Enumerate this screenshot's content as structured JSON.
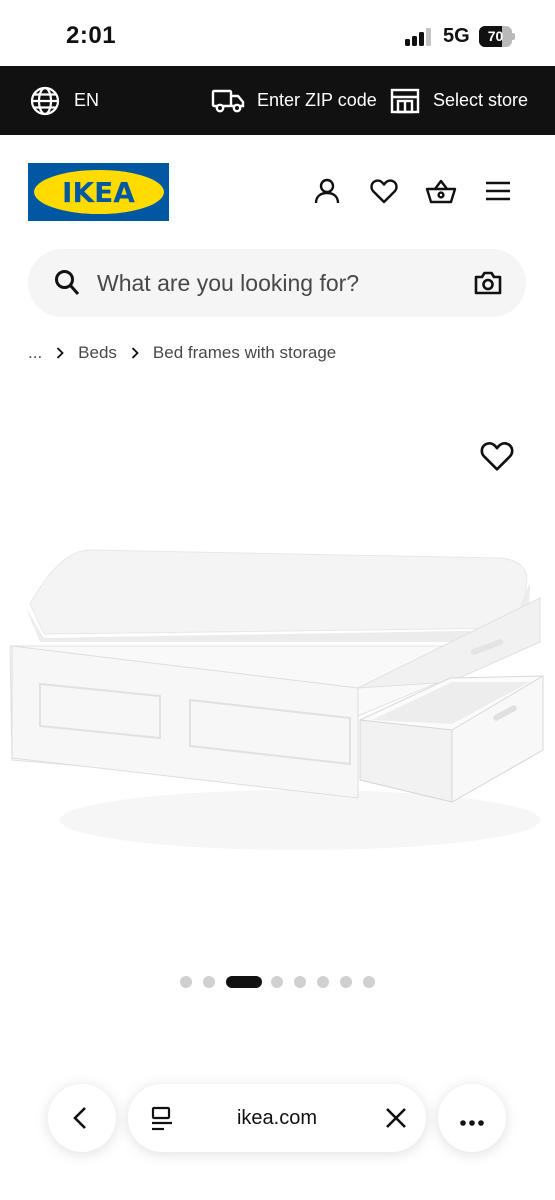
{
  "status_bar": {
    "time": "2:01",
    "network": "5G",
    "battery_level": "70",
    "battery_fraction": 0.7,
    "signal_bars_active": 3,
    "signal_bars_total": 4
  },
  "top_strip": {
    "language": "EN",
    "language_icon": "globe-icon",
    "zip_label": "Enter ZIP code",
    "zip_icon": "truck-icon",
    "store_label": "Select store",
    "store_icon": "store-icon"
  },
  "header": {
    "logo_text": "IKEA",
    "icons": [
      "account-icon",
      "favorites-heart-icon",
      "shopping-basket-icon",
      "hamburger-menu-icon"
    ]
  },
  "search": {
    "placeholder": "What are you looking for?",
    "icon": "search-icon",
    "camera_icon": "camera-icon"
  },
  "breadcrumb": {
    "ellipsis": "...",
    "items": [
      "Beds",
      "Bed frames with storage"
    ]
  },
  "product": {
    "image_subject": "white bed frame with storage drawers",
    "favorite_icon": "heart-icon"
  },
  "carousel": {
    "dot_count": 8,
    "active_index": 2
  },
  "browser_bar": {
    "url": "ikea.com",
    "back_icon": "chevron-left-icon",
    "reader_icon": "reader-icon",
    "close_icon": "close-icon",
    "more_icon": "more-dots-icon"
  },
  "colors": {
    "ikea_blue": "#0058a3",
    "ikea_yellow": "#ffdb00",
    "strip_black": "#111111",
    "search_bg": "#f5f5f5"
  }
}
